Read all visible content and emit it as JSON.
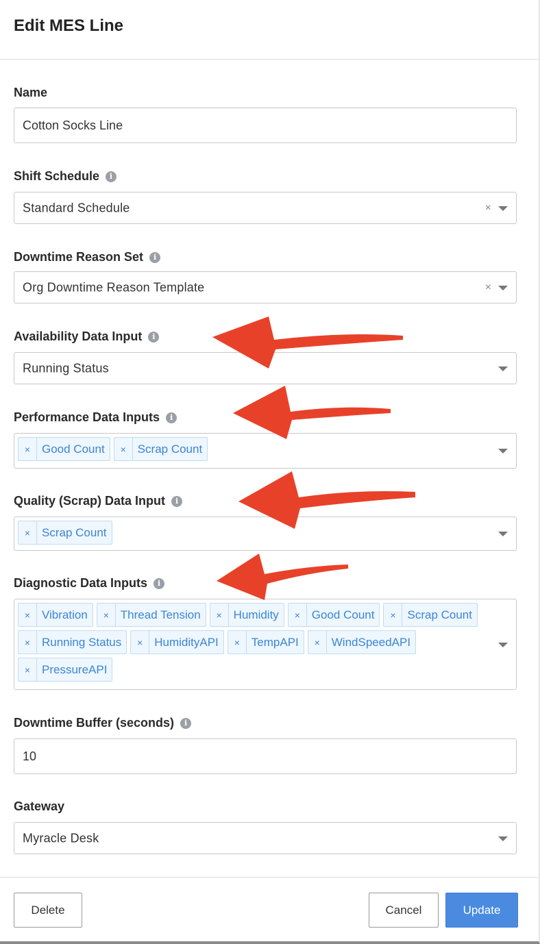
{
  "modal": {
    "title": "Edit MES Line"
  },
  "fields": {
    "name": {
      "label": "Name",
      "value": "Cotton Socks Line"
    },
    "shift_schedule": {
      "label": "Shift Schedule",
      "value": "Standard Schedule",
      "clear": "×"
    },
    "downtime_reason_set": {
      "label": "Downtime Reason Set",
      "value": "Org Downtime Reason Template",
      "clear": "×"
    },
    "availability": {
      "label": "Availability Data Input",
      "value": "Running Status"
    },
    "performance": {
      "label": "Performance Data Inputs",
      "tags": [
        "Good Count",
        "Scrap Count"
      ]
    },
    "quality": {
      "label": "Quality (Scrap) Data Input",
      "tags": [
        "Scrap Count"
      ]
    },
    "diagnostic": {
      "label": "Diagnostic Data Inputs",
      "tags": [
        "Vibration",
        "Thread Tension",
        "Humidity",
        "Good Count",
        "Scrap Count",
        "Running Status",
        "HumidityAPI",
        "TempAPI",
        "WindSpeedAPI",
        "PressureAPI"
      ]
    },
    "downtime_buffer": {
      "label": "Downtime Buffer (seconds)",
      "value": "10"
    },
    "gateway": {
      "label": "Gateway",
      "value": "Myracle Desk"
    }
  },
  "tag_remove": "×",
  "info_glyph": "i",
  "footer": {
    "delete_label": "Delete",
    "cancel_label": "Cancel",
    "update_label": "Update"
  },
  "colors": {
    "accent": "#4a8be0",
    "tag_text": "#3a86d6",
    "arrow": "#e8412a"
  }
}
